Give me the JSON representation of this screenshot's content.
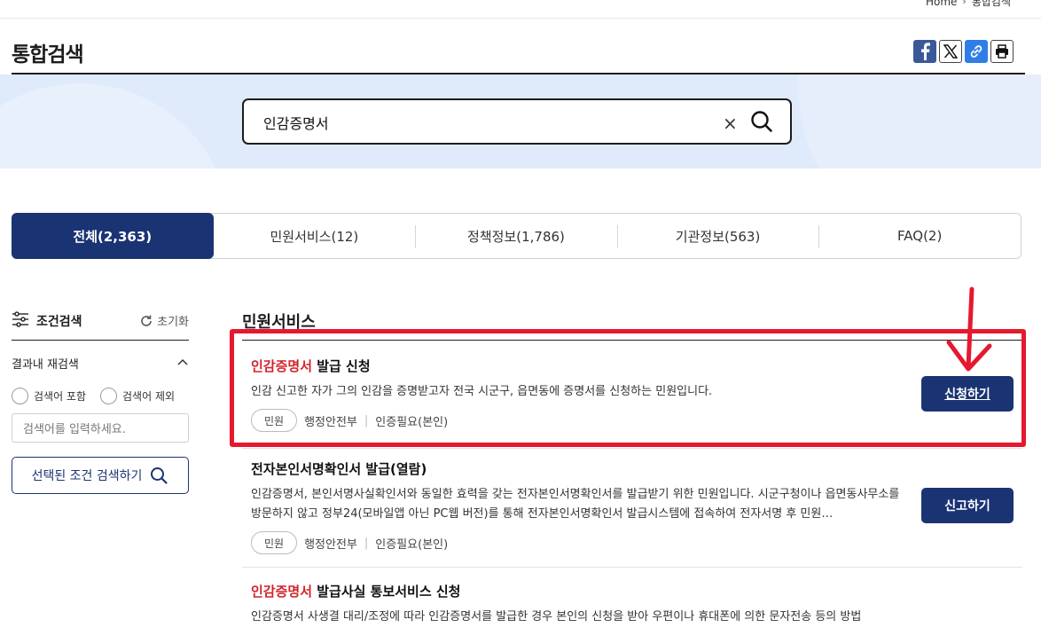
{
  "breadcrumb": {
    "home": "Home",
    "current": "통합검색"
  },
  "page_title": "통합검색",
  "search": {
    "value": "인감증명서"
  },
  "tabs": [
    {
      "label": "전체(2,363)"
    },
    {
      "label": "민원서비스(12)"
    },
    {
      "label": "정책정보(1,786)"
    },
    {
      "label": "기관정보(563)"
    },
    {
      "label": "FAQ(2)"
    }
  ],
  "sidebar": {
    "title": "조건검색",
    "reset": "초기화",
    "subsearch": "결과내 재검색",
    "include": "검색어 포함",
    "exclude": "검색어 제외",
    "placeholder": "검색어를 입력하세요.",
    "apply": "선택된 조건 검색하기"
  },
  "results": {
    "section_title": "민원서비스",
    "items": [
      {
        "title_hl": "인감증명서",
        "title_rest": " 발급 신청",
        "desc": "인감 신고한 자가 그의 인감을 증명받고자 전국 시군구, 읍면동에 증명서를 신청하는 민원입니다.",
        "badge": "민원",
        "org": "행정안전부",
        "auth": "인증필요(본인)",
        "action": "신청하기"
      },
      {
        "title_hl": "",
        "title_rest": "전자본인서명확인서 발급(열람)",
        "desc": "인감증명서, 본인서명사실확인서와 동일한 효력을 갖는 전자본인서명확인서를 발급받기 위한 민원입니다. 시군구청이나 읍면동사무소를 방문하지 않고 정부24(모바일앱 아닌 PC웹 버전)를 통해 전자본인서명확인서 발급시스템에 접속하여 전자서명 후 민원…",
        "badge": "민원",
        "org": "행정안전부",
        "auth": "인증필요(본인)",
        "action": "신고하기"
      },
      {
        "title_hl": "인감증명서",
        "title_rest": " 발급사실 통보서비스 신청",
        "desc": "인감증명서 사생결 대리/조정에 따라 인감증명서를 발급한 경우 본인의 신청을 받아 우편이나 휴대폰에 의한 문자전송 등의 방법"
      }
    ]
  },
  "colors": {
    "primary": "#1a3473",
    "highlight": "#d2232a",
    "annotation": "#e5192e",
    "band": "#dfeafb"
  }
}
